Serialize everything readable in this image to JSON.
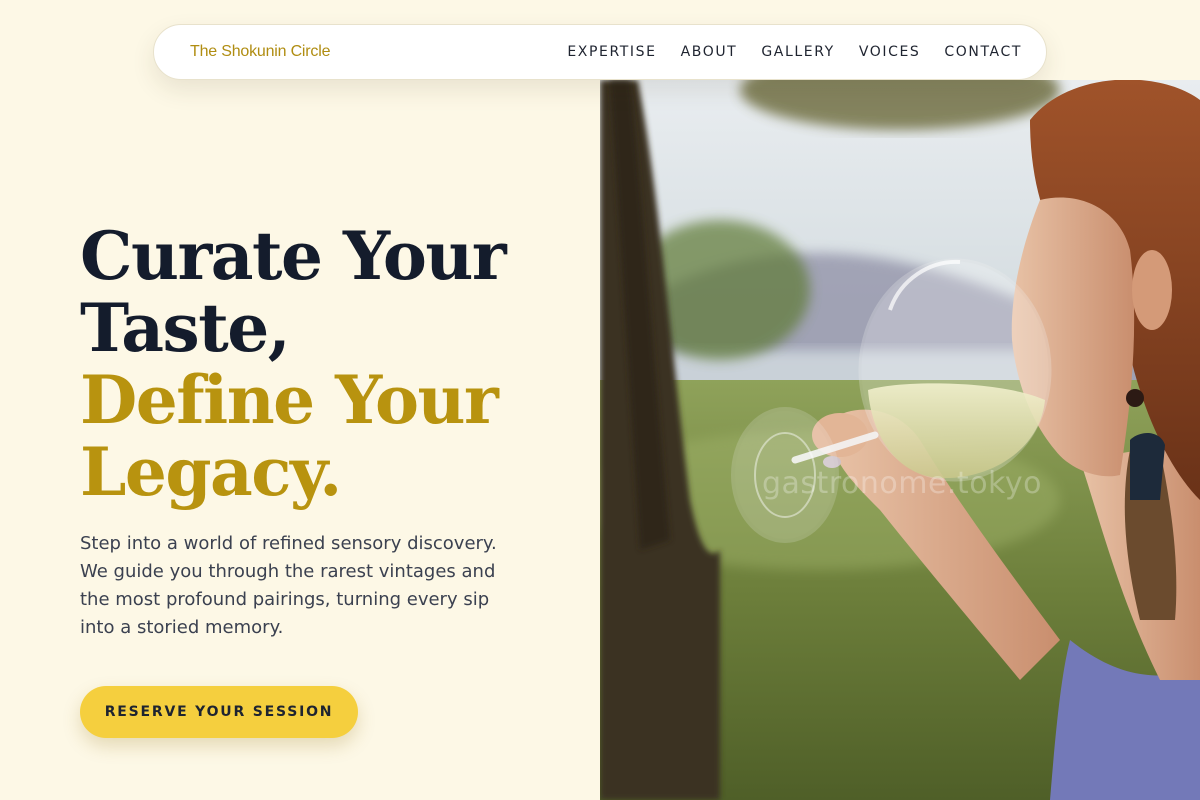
{
  "nav": {
    "brand": "The Shokunin Circle",
    "links": [
      {
        "label": "EXPERTISE"
      },
      {
        "label": "ABOUT"
      },
      {
        "label": "GALLERY"
      },
      {
        "label": "VOICES"
      },
      {
        "label": "CONTACT"
      }
    ]
  },
  "hero": {
    "headline_line1": "Curate Your",
    "headline_line2": "Taste,",
    "headline_line3": "Define Your",
    "headline_line4": "Legacy.",
    "description": "Step into a world of refined sensory discovery. We guide you through the rarest vintages and the most profound pairings, turning every sip into a storied memory.",
    "cta_label": "RESERVE YOUR SESSION",
    "image_watermark": "gastronome.tokyo"
  },
  "colors": {
    "background": "#fdf8e6",
    "brand_gold": "#b08d12",
    "headline_dark": "#141c2c",
    "headline_gold": "#b8930f",
    "cta_yellow": "#f5cf3e"
  }
}
